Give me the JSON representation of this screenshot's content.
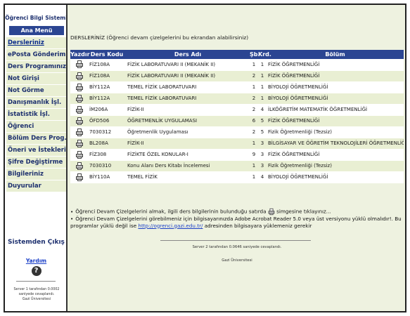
{
  "sidebar": {
    "system_title": "Öğrenci Bilgi Sistemi",
    "menu_header": "Ana Menü",
    "items": [
      {
        "label": "Dersleriniz",
        "active": true
      },
      {
        "label": "ePosta Gönderimi"
      },
      {
        "label": "Ders Programınız"
      },
      {
        "label": "Not Girişi"
      },
      {
        "label": "Not Görme"
      },
      {
        "label": "Danışmanlık İşl."
      },
      {
        "label": "İstatistik İşl."
      },
      {
        "label": "Öğrenci"
      },
      {
        "label": "Bölüm Ders Prog."
      },
      {
        "label": "Öneri ve İstekleriniz"
      },
      {
        "label": "Şifre Değiştirme"
      },
      {
        "label": "Bilgileriniz"
      },
      {
        "label": "Duyurular"
      }
    ],
    "logout": "Sistemden Çıkış",
    "help_label": "Yardım",
    "help_icon": "?",
    "footer_text": "Server 1 tarafından 0.0002 saniyede cevaplandı.",
    "footer_text2": "Gazi Üniversitesi"
  },
  "main": {
    "header": "DERSLERİNİZ (Öğrenci devam çizelgelerini bu ekrandan alabilirsiniz)",
    "columns": {
      "print": "Yazdır",
      "code": "Ders Kodu",
      "name": "Ders Adı",
      "section": "Şb.",
      "credit": "Krd.",
      "department": "Bölüm"
    },
    "rows": [
      {
        "code": "FİZ108A",
        "name": "FİZİK LABORATUVARI II (MEKANİK II)",
        "section": "1",
        "credit": "1",
        "department": "FİZİK ÖĞRETMENLİĞİ"
      },
      {
        "code": "FİZ108A",
        "name": "FİZİK LABORATUVARI II (MEKANİK II)",
        "section": "2",
        "credit": "1",
        "department": "FİZİK ÖĞRETMENLİĞİ"
      },
      {
        "code": "BİY112A",
        "name": "TEMEL FİZİK LABORATUVARI",
        "section": "1",
        "credit": "1",
        "department": "BİYOLOJİ ÖĞRETMENLİĞİ"
      },
      {
        "code": "BİY112A",
        "name": "TEMEL FİZİK LABORATUVARI",
        "section": "2",
        "credit": "1",
        "department": "BİYOLOJİ ÖĞRETMENLİĞİ"
      },
      {
        "code": "İM206A",
        "name": "FİZİK-II",
        "section": "2",
        "credit": "4",
        "department": "İLKÖĞRETİM MATEMATİK ÖĞRETMENLİĞİ"
      },
      {
        "code": "ÖFD506",
        "name": "ÖĞRETMENLİK UYGULAMASI",
        "section": "6",
        "credit": "5",
        "department": "FİZİK ÖĞRETMENLİĞİ"
      },
      {
        "code": "7030312",
        "name": "Öğretmenlik Uygulaması",
        "section": "2",
        "credit": "5",
        "department": "Fizik Öğretmenliği (Tezsiz)"
      },
      {
        "code": "BL208A",
        "name": "FİZİK-II",
        "section": "1",
        "credit": "3",
        "department": "BİLGİSAYAR VE ÖĞRETİM TEKNOLOJİLERİ ÖĞRETMENLİĞİ"
      },
      {
        "code": "FİZ308",
        "name": "FİZİKTE ÖZEL KONULAR-I",
        "section": "9",
        "credit": "3",
        "department": "FİZİK ÖĞRETMENLİĞİ"
      },
      {
        "code": "7030310",
        "name": "Konu Alanı Ders Kitabı İncelemesi",
        "section": "1",
        "credit": "3",
        "department": "Fizik Öğretmenliği (Tezsiz)"
      },
      {
        "code": "BİY110A",
        "name": "TEMEL FİZİK",
        "section": "1",
        "credit": "4",
        "department": "BİYOLOJİ ÖĞRETMENLİĞİ"
      }
    ],
    "note1_before": "Öğrenci Devam Çizelgelerini almak, ilgili ders bilgilerinin bulunduğu satırda",
    "note1_after": "simgesine tıklayınız...",
    "note2": "Öğrenci Devam Çizelgelerini görebilmeniz için bilgisayarınızda Adobe Acrobat Reader 5.0 veya üst versiyonu yüklü olmalıdır!. Bu programlar yüklü değil ise",
    "note2_link": "http://ogrenci.gazi.edu.tr/",
    "note2_after": "adresinden bilgisayara yüklemeniz gerekir",
    "footer_text": "Server 2 tarafından 0.0646 saniyede cevaplandı.",
    "footer_text2": "Gazi Üniversitesi"
  },
  "colors": {
    "accent": "#2b4592",
    "row_alt": "#e9efd3",
    "link": "#1a3fc8",
    "page_bg": "#eef2e0"
  }
}
